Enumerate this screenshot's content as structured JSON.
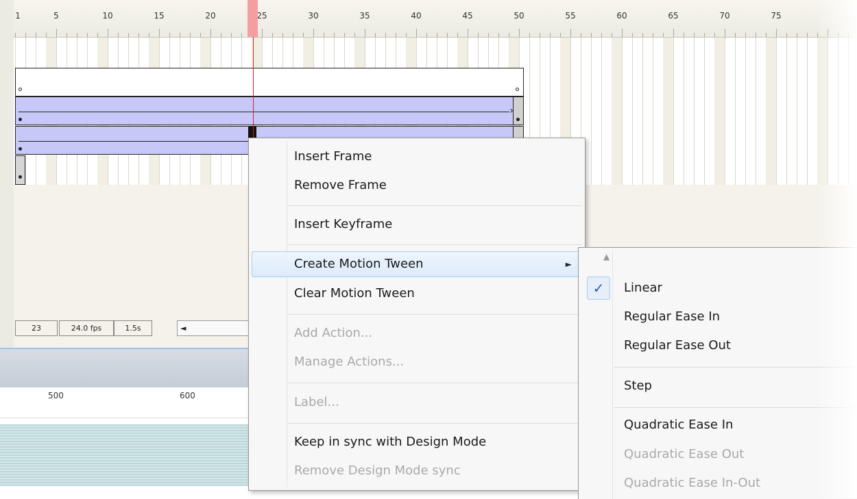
{
  "ruler": {
    "labels": [
      "1",
      "5",
      "10",
      "15",
      "20",
      "25",
      "30",
      "35",
      "40",
      "45",
      "50",
      "55",
      "60",
      "65",
      "70",
      "75"
    ]
  },
  "status": {
    "frame": "23",
    "fps": "24.0 fps",
    "time": "1.5s",
    "scroll_left": "◄"
  },
  "panel": {
    "ruler_labels": [
      "500",
      "600"
    ]
  },
  "context_menu": {
    "items": [
      {
        "label": "Insert Frame",
        "enabled": true
      },
      {
        "label": "Remove Frame",
        "enabled": true
      },
      {
        "label": "Insert Keyframe",
        "enabled": true
      },
      {
        "label": "Create Motion Tween",
        "enabled": true,
        "submenu_arrow": "►"
      },
      {
        "label": "Clear Motion Tween",
        "enabled": true
      },
      {
        "label": "Add Action...",
        "enabled": false
      },
      {
        "label": "Manage Actions...",
        "enabled": false
      },
      {
        "label": "Label...",
        "enabled": false
      },
      {
        "label": "Keep in sync with Design Mode",
        "enabled": true
      },
      {
        "label": "Remove Design Mode sync",
        "enabled": false
      }
    ]
  },
  "submenu": {
    "scroll_up": "▲",
    "check": "✓",
    "items": [
      {
        "label": "Linear",
        "checked": true,
        "enabled": true
      },
      {
        "label": "Regular Ease In",
        "enabled": true
      },
      {
        "label": "Regular Ease Out",
        "enabled": true
      },
      {
        "label": "Step",
        "enabled": true
      },
      {
        "label": "Quadratic Ease In",
        "enabled": true
      },
      {
        "label": "Quadratic Ease Out",
        "enabled": false
      },
      {
        "label": "Quadratic Ease In-Out",
        "enabled": false
      }
    ]
  },
  "colors": {
    "tween_fill": "#c8c8f8",
    "playhead": "#cc2222",
    "playhead_tab": "#f59ea0",
    "menu_highlight": "#dcebfc",
    "check_color": "#2a5fb0"
  }
}
